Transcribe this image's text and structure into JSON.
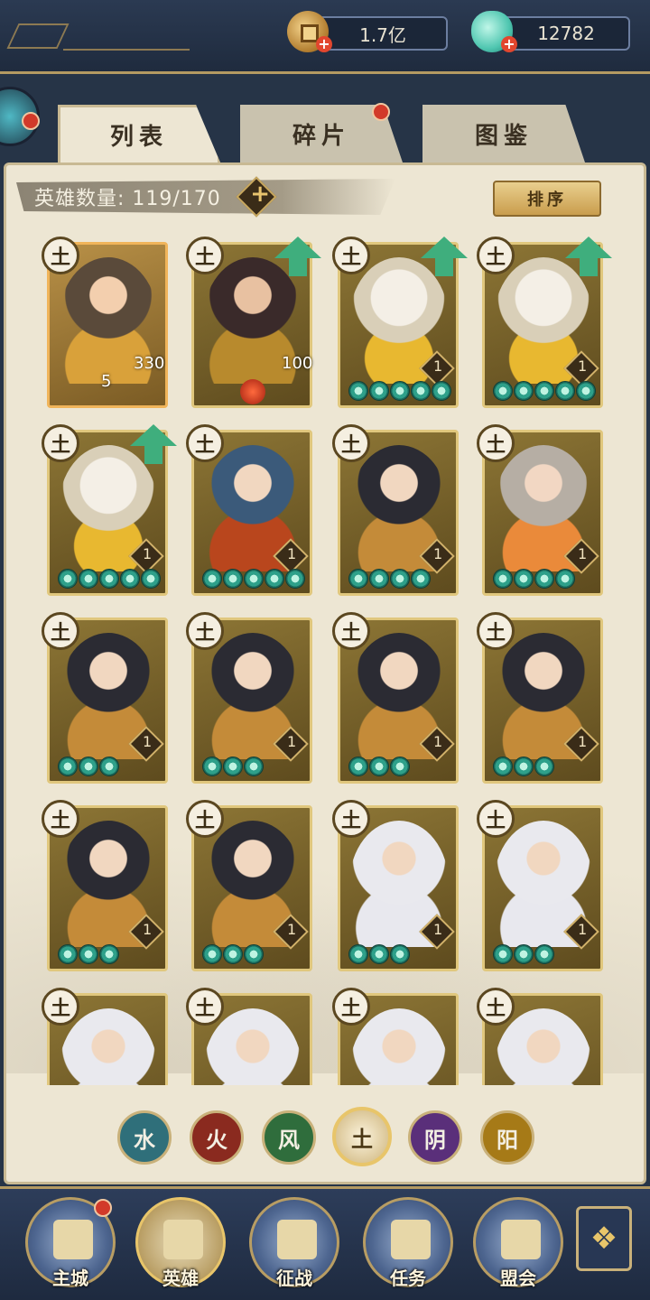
{
  "currency": {
    "gold": "1.7亿",
    "jade": "12782"
  },
  "tabs": [
    {
      "label": "列表",
      "active": true
    },
    {
      "label": "碎片",
      "active": false,
      "notify": true
    },
    {
      "label": "图鉴",
      "active": false
    }
  ],
  "hero_count_label": "英雄数量: 119/170",
  "sort_label": "排序",
  "element_badge": "土",
  "heroes": [
    {
      "art": "brown",
      "level": "5",
      "power": "330",
      "frame": "orange"
    },
    {
      "art": "lord",
      "power": "100",
      "upgrade": true
    },
    {
      "art": "white",
      "level": "1",
      "stars": 5,
      "upgrade": true
    },
    {
      "art": "white",
      "level": "1",
      "stars": 5,
      "upgrade": true
    },
    {
      "art": "white",
      "level": "1",
      "stars": 5,
      "upgrade": true
    },
    {
      "art": "red",
      "level": "1",
      "stars": 5
    },
    {
      "art": "dark",
      "level": "1",
      "stars": 4
    },
    {
      "art": "grey",
      "level": "1",
      "stars": 4
    },
    {
      "art": "dark",
      "level": "1",
      "stars": 3
    },
    {
      "art": "dark",
      "level": "1",
      "stars": 3
    },
    {
      "art": "dark",
      "level": "1",
      "stars": 3
    },
    {
      "art": "dark",
      "level": "1",
      "stars": 3
    },
    {
      "art": "dark",
      "level": "1",
      "stars": 3
    },
    {
      "art": "dark",
      "level": "1",
      "stars": 3
    },
    {
      "art": "silver",
      "level": "1",
      "stars": 3
    },
    {
      "art": "silver",
      "level": "1",
      "stars": 3
    },
    {
      "art": "silver"
    },
    {
      "art": "silver"
    },
    {
      "art": "silver"
    },
    {
      "art": "silver"
    }
  ],
  "element_filters": [
    {
      "label": "水",
      "color": "#2f6f7a"
    },
    {
      "label": "火",
      "color": "#8a2a1f"
    },
    {
      "label": "风",
      "color": "#2f6d3c"
    },
    {
      "label": "土",
      "color": "#cdb37a",
      "active": true
    },
    {
      "label": "阴",
      "color": "#5a2f7a"
    },
    {
      "label": "阳",
      "color": "#a67a17"
    }
  ],
  "nav": [
    {
      "label": "主城",
      "notify": true
    },
    {
      "label": "英雄",
      "active": true
    },
    {
      "label": "征战"
    },
    {
      "label": "任务"
    },
    {
      "label": "盟会"
    }
  ]
}
